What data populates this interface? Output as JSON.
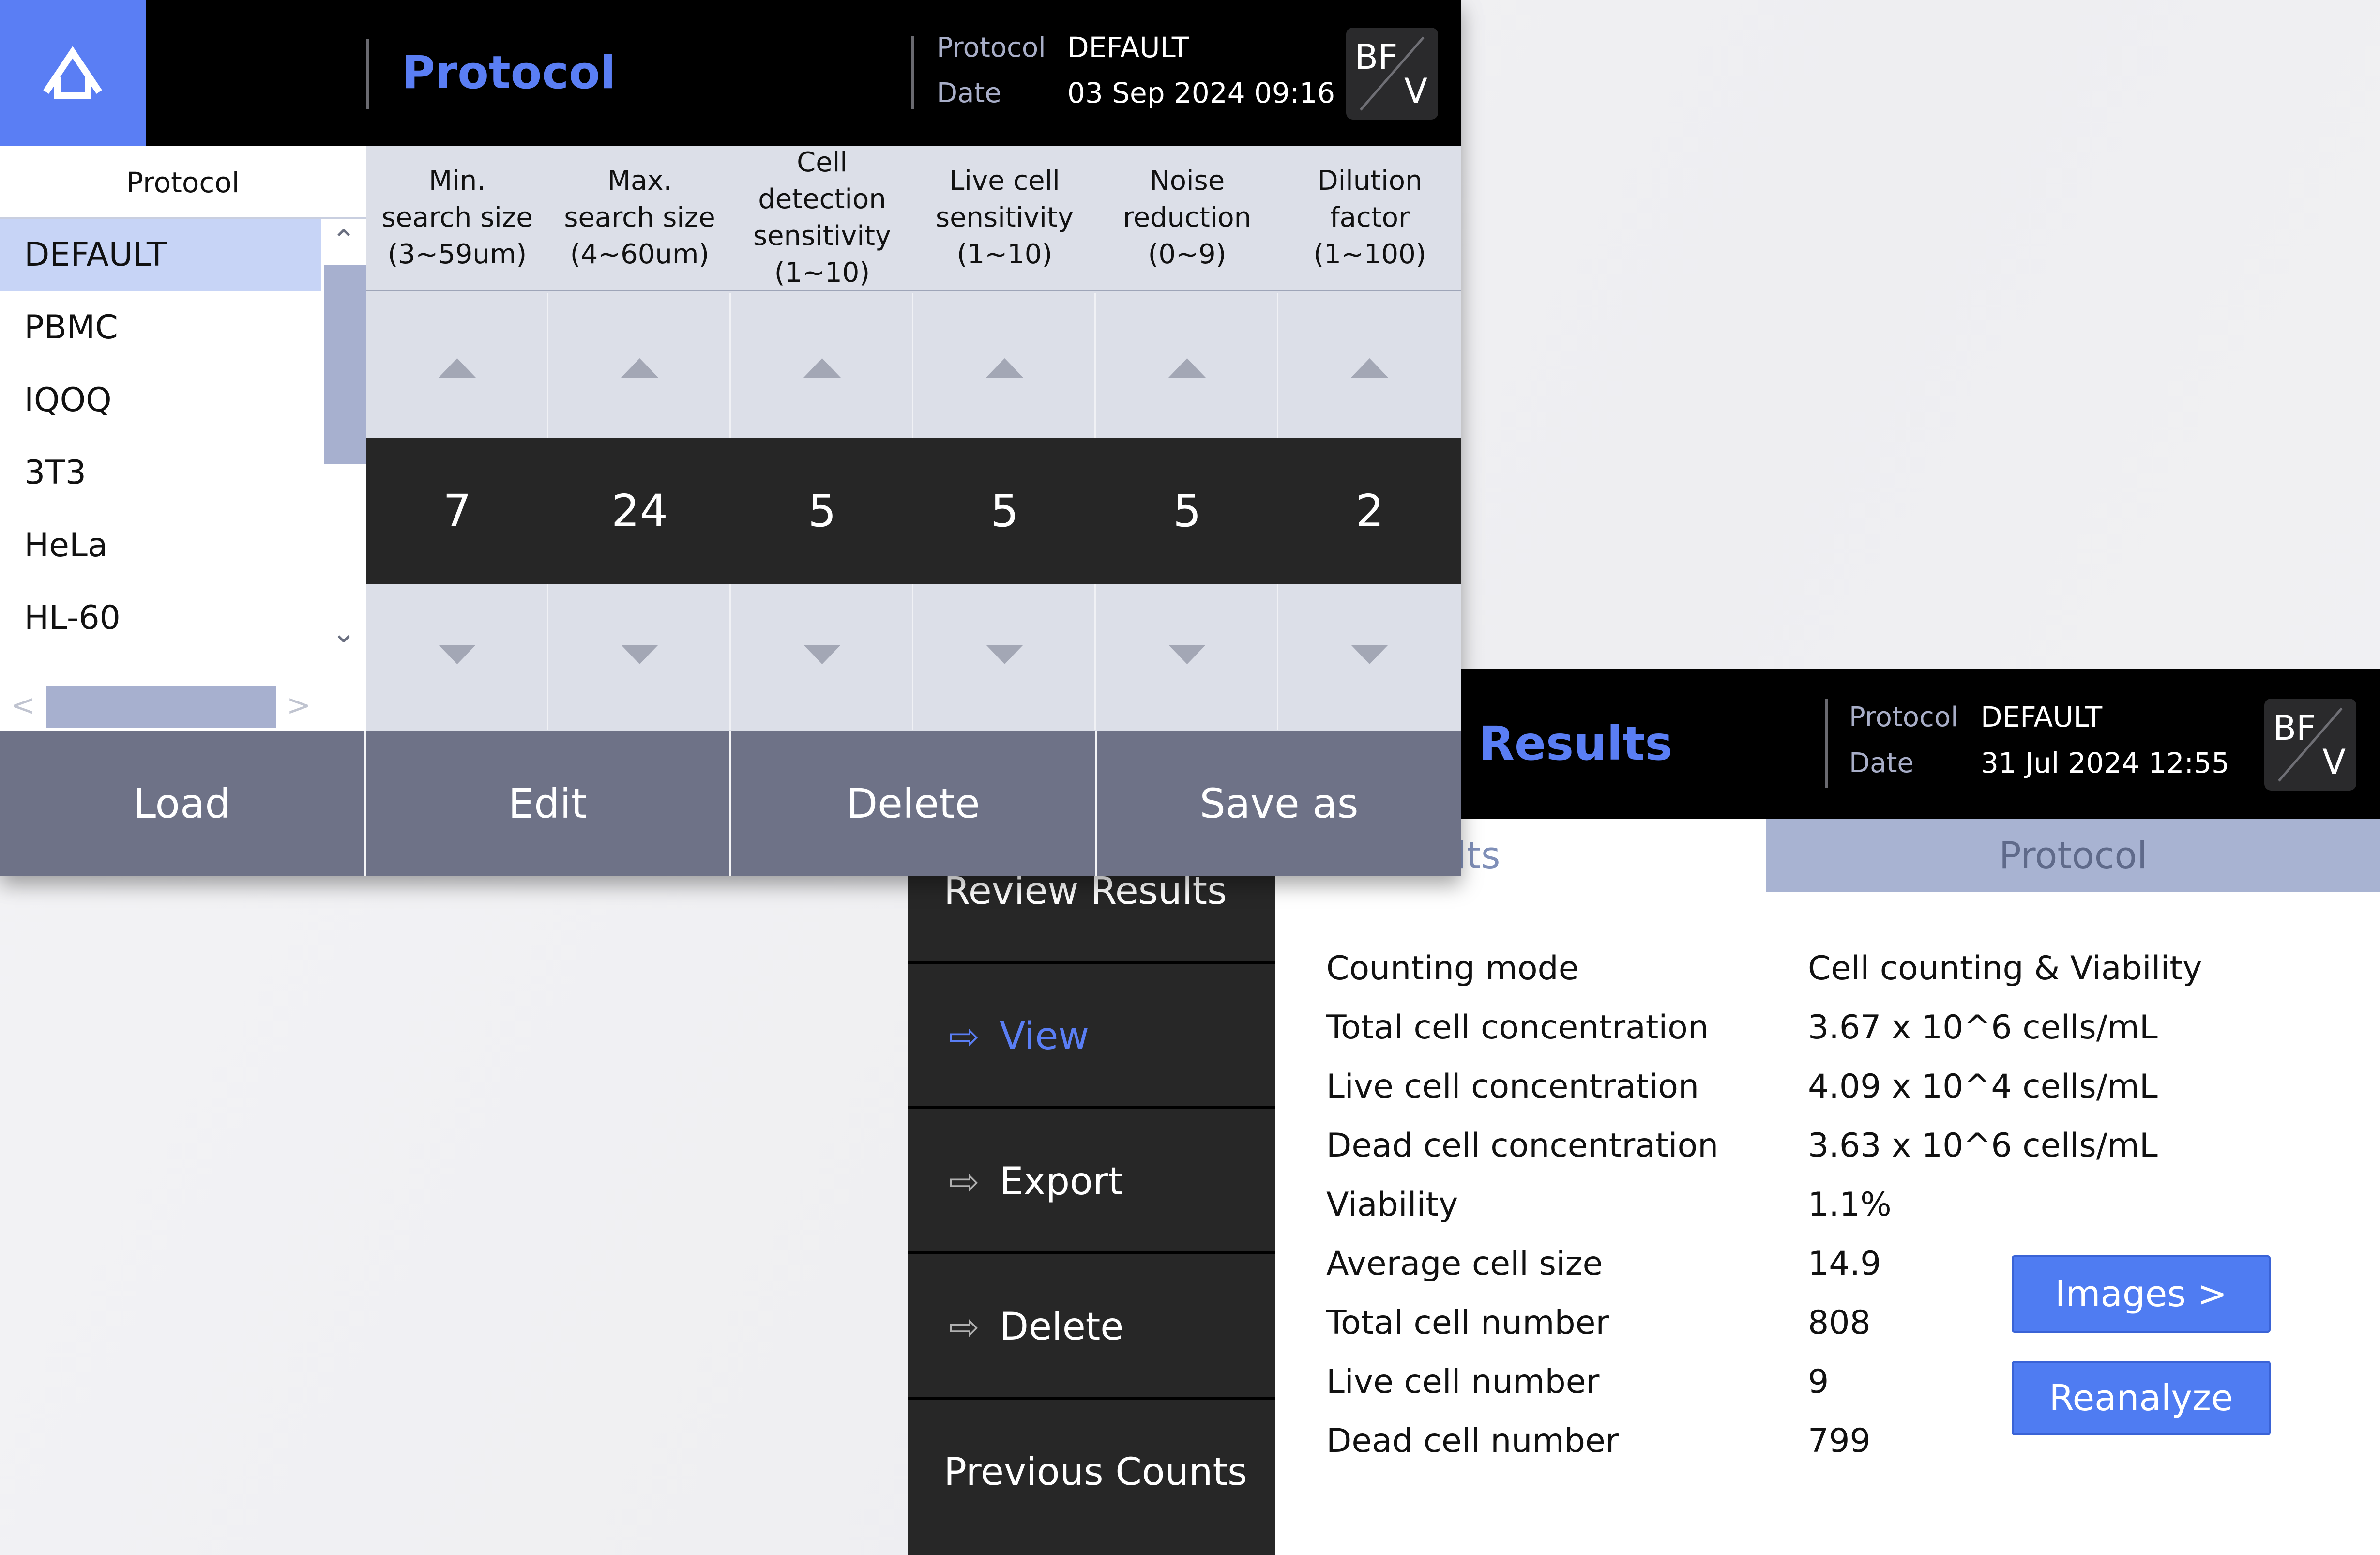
{
  "protocol_window": {
    "title": "Protocol",
    "meta": {
      "protocol_label": "Protocol",
      "protocol_value": "DEFAULT",
      "date_label": "Date",
      "date_value": "03 Sep 2024 09:16"
    },
    "mode_badge": {
      "top": "BF",
      "bottom": "V"
    },
    "list": {
      "header": "Protocol",
      "items": [
        "DEFAULT",
        "PBMC",
        "IQOQ",
        "3T3",
        "HeLa",
        "HL-60"
      ],
      "selected": "DEFAULT"
    },
    "columns": [
      {
        "header": "Min.\nsearch size\n(3~59um)",
        "value": "7"
      },
      {
        "header": "Max.\nsearch size\n(4~60um)",
        "value": "24"
      },
      {
        "header": "Cell\ndetection\nsensitivity\n(1~10)",
        "value": "5"
      },
      {
        "header": "Live cell\nsensitivity\n(1~10)",
        "value": "5"
      },
      {
        "header": "Noise\nreduction\n(0~9)",
        "value": "5"
      },
      {
        "header": "Dilution\nfactor\n(1~100)",
        "value": "2"
      }
    ],
    "buttons": {
      "load": "Load",
      "edit": "Edit",
      "delete": "Delete",
      "save_as": "Save as"
    }
  },
  "results_window": {
    "title": "Results",
    "meta": {
      "protocol_label": "Protocol",
      "protocol_value": "DEFAULT",
      "date_label": "Date",
      "date_value": "31 Jul 2024 12:55"
    },
    "mode_badge": {
      "top": "BF",
      "bottom": "V"
    },
    "tabs": {
      "results": "Results",
      "protocol": "Protocol"
    },
    "sidebar": {
      "section": "Review Results",
      "view": "View",
      "export": "Export",
      "delete": "Delete",
      "previous": "Previous Counts"
    },
    "rows": [
      {
        "label": "Counting mode",
        "value": "Cell counting & Viability"
      },
      {
        "label": "Total cell concentration",
        "value": "3.67 x 10^6 cells/mL"
      },
      {
        "label": "Live cell concentration",
        "value": "4.09 x 10^4 cells/mL"
      },
      {
        "label": "Dead cell concentration",
        "value": "3.63 x 10^6 cells/mL"
      },
      {
        "label": "Viability",
        "value": "1.1%"
      },
      {
        "label": "Average cell size",
        "value": "14.9"
      },
      {
        "label": "Total cell number",
        "value": "808"
      },
      {
        "label": "Live cell number",
        "value": "9"
      },
      {
        "label": "Dead cell number",
        "value": "799"
      }
    ],
    "buttons": {
      "images": "Images >",
      "reanalyze": "Reanalyze"
    }
  },
  "colors": {
    "accent": "#5a7ef4",
    "header_bg": "#000000",
    "selected_item": "#c7d4f6",
    "button_bar": "#6e7287",
    "value_row": "#262626"
  },
  "icons": {
    "home": "home-icon",
    "arrow_right": "arrow-right-icon",
    "triangle_up": "triangle-up-icon",
    "triangle_down": "triangle-down-icon"
  }
}
